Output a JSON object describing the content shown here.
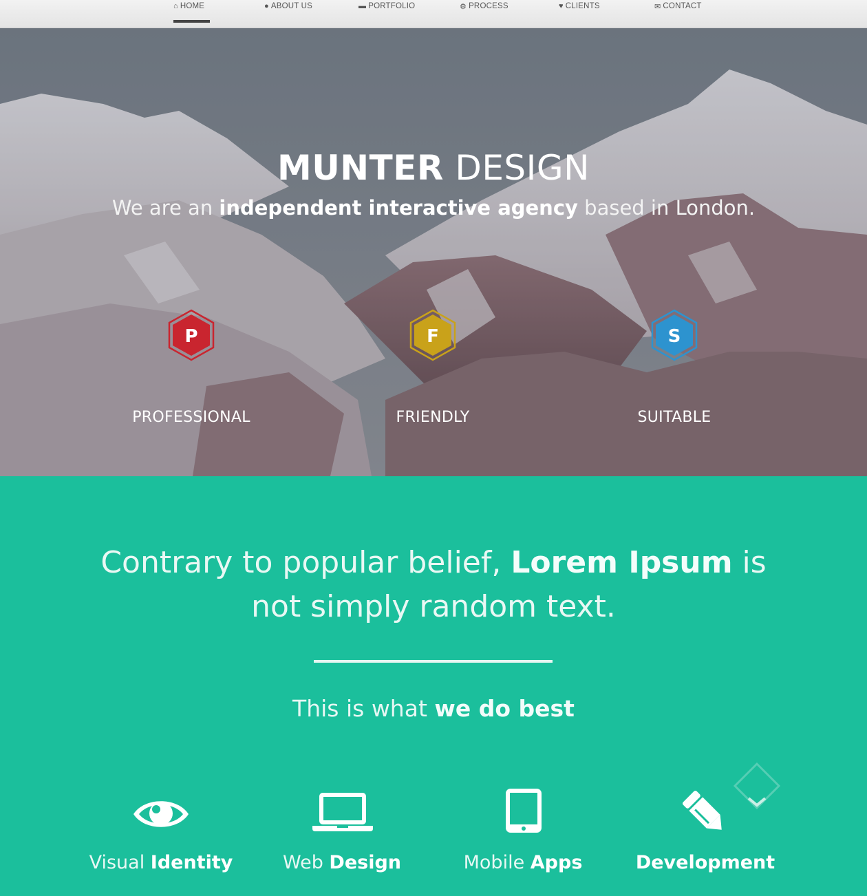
{
  "nav": {
    "items": [
      {
        "label": "HOME",
        "icon": "home-icon",
        "glyph": "⌂",
        "active": true
      },
      {
        "label": "ABOUT US",
        "icon": "user-icon",
        "glyph": "●",
        "active": false
      },
      {
        "label": "PORTFOLIO",
        "icon": "briefcase-icon",
        "glyph": "▬",
        "active": false
      },
      {
        "label": "PROCESS",
        "icon": "gears-icon",
        "glyph": "⚙",
        "active": false
      },
      {
        "label": "CLIENTS",
        "icon": "heart-icon",
        "glyph": "♥",
        "active": false
      },
      {
        "label": "CONTACT",
        "icon": "envelope-icon",
        "glyph": "✉",
        "active": false
      }
    ]
  },
  "hero": {
    "title_bold": "MUNTER",
    "title_light": " DESIGN",
    "subtitle_pre": "We are an ",
    "subtitle_bold": "independent interactive agency",
    "subtitle_post": " based in London.",
    "badges": [
      {
        "letter": "P",
        "label": "PROFESSIONAL",
        "color": "#c9252f",
        "icon": "hexagon-p-icon"
      },
      {
        "letter": "F",
        "label": "FRIENDLY",
        "color": "#c9a21a",
        "icon": "hexagon-f-icon"
      },
      {
        "letter": "S",
        "label": "SUITABLE",
        "color": "#2d93cf",
        "icon": "hexagon-s-icon"
      }
    ]
  },
  "intro": {
    "pre": "Contrary to popular belief, ",
    "bold": "Lorem Ipsum",
    "post": " is not simply random text.",
    "best_pre": "This is what ",
    "best_bold": "we do best"
  },
  "services": [
    {
      "light": "Visual ",
      "bold": "Identity",
      "icon": "eye-icon"
    },
    {
      "light": "Web ",
      "bold": "Design",
      "icon": "laptop-icon"
    },
    {
      "light": "Mobile ",
      "bold": "Apps",
      "icon": "tablet-icon"
    },
    {
      "light": "",
      "bold": "Development",
      "icon": "pencil-icon"
    }
  ],
  "colors": {
    "accent": "#1bbf9c",
    "nav_bg": "#ececec"
  }
}
